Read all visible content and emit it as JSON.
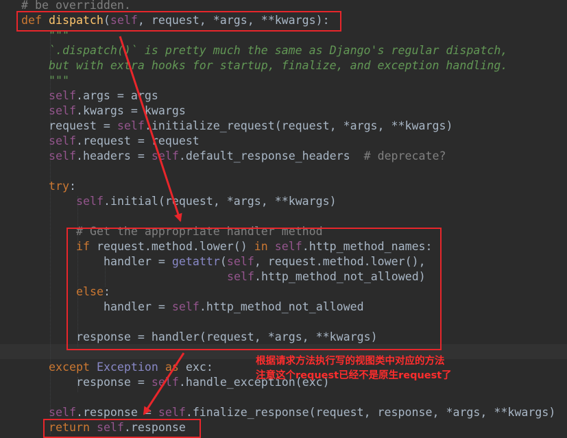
{
  "code": {
    "l00": [
      "# be overridden."
    ],
    "l01": [
      "def",
      "dispatch",
      "(",
      "self",
      ", request, *args, **kwargs):"
    ],
    "l02": [
      "\"\"\""
    ],
    "l03": [
      "`.dispatch()` is pretty much the same as Django's regular dispatch,"
    ],
    "l04": [
      "but with extra hooks for startup, finalize, and exception handling."
    ],
    "l05": [
      "\"\"\""
    ],
    "l06": [
      "self",
      ".args = args"
    ],
    "l07": [
      "self",
      ".kwargs = kwargs"
    ],
    "l08": [
      "request = ",
      "self",
      ".initialize_request(request, *args, **kwargs)"
    ],
    "l09": [
      "self",
      ".request = request"
    ],
    "l10": [
      "self",
      ".headers = ",
      "self",
      ".default_response_headers  ",
      "# deprecate?"
    ],
    "l11": [
      "try",
      ":"
    ],
    "l12": [
      "self",
      ".initial(request, *args, **kwargs)"
    ],
    "l13": [
      "# Get the appropriate handler method"
    ],
    "l14": [
      "if",
      " request.method.lower() ",
      "in",
      " ",
      "self",
      ".http_method_names:"
    ],
    "l15": [
      "handler = ",
      "getattr",
      "(",
      "self",
      ", request.method.lower(),"
    ],
    "l16": [
      "self",
      ".http_method_not_allowed)"
    ],
    "l17": [
      "else",
      ":"
    ],
    "l18": [
      "handler = ",
      "self",
      ".http_method_not_allowed"
    ],
    "l19": [
      "response = handler(request, *args, **kwargs)"
    ],
    "l20": [
      "except",
      " ",
      "Exception",
      " ",
      "as",
      " exc:"
    ],
    "l21": [
      "response = ",
      "self",
      ".handle_exception(exc)"
    ],
    "l22": [
      "self",
      ".response = ",
      "self",
      ".finalize_response(request, response, *args, **kwargs)"
    ],
    "l23": [
      "return",
      " ",
      "self",
      ".response"
    ]
  },
  "annotation": {
    "line1": "根据请求方法执行写的视图类中对应的方法",
    "line2": "注意这个request已经不是原生request了"
  },
  "colors": {
    "background": "#2b2b2b",
    "keyword": "#cc7832",
    "self": "#94558d",
    "function": "#ffc66d",
    "docstring": "#629755",
    "comment": "#808080",
    "text": "#a9b7c6",
    "highlight": "#e8262b"
  }
}
